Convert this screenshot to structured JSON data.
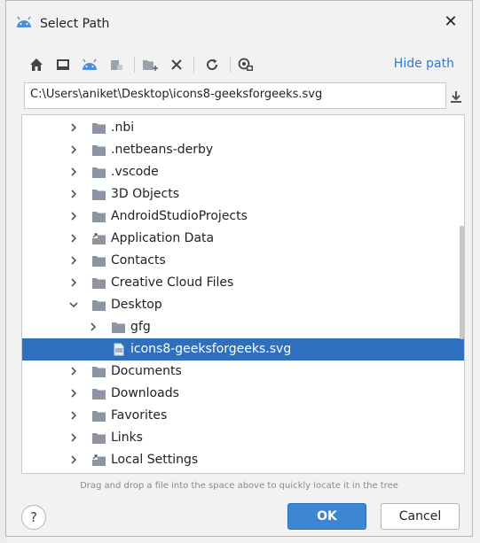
{
  "window": {
    "title": "Select Path"
  },
  "toolbar": {
    "buttons": [
      {
        "name": "home-icon"
      },
      {
        "name": "desktop-icon"
      },
      {
        "name": "android-project-icon"
      },
      {
        "name": "module-icon"
      },
      {
        "name": "new-folder-icon"
      },
      {
        "name": "delete-icon"
      },
      {
        "name": "refresh-icon"
      },
      {
        "name": "show-hidden-icon"
      }
    ],
    "hide_path_label": "Hide path"
  },
  "path": {
    "value": "C:\\Users\\aniket\\Desktop\\icons8-geeksforgeeks.svg"
  },
  "tree": {
    "items": [
      {
        "label": ".nbi",
        "type": "folder",
        "expanded": false,
        "level": 0
      },
      {
        "label": ".netbeans-derby",
        "type": "folder",
        "expanded": false,
        "level": 0
      },
      {
        "label": ".vscode",
        "type": "folder",
        "expanded": false,
        "level": 0
      },
      {
        "label": "3D Objects",
        "type": "folder",
        "expanded": false,
        "level": 0
      },
      {
        "label": "AndroidStudioProjects",
        "type": "folder",
        "expanded": false,
        "level": 0
      },
      {
        "label": "Application Data",
        "type": "folder-link",
        "expanded": false,
        "level": 0
      },
      {
        "label": "Contacts",
        "type": "folder",
        "expanded": false,
        "level": 0
      },
      {
        "label": "Creative Cloud Files",
        "type": "folder",
        "expanded": false,
        "level": 0
      },
      {
        "label": "Desktop",
        "type": "folder",
        "expanded": true,
        "level": 0
      },
      {
        "label": "gfg",
        "type": "folder",
        "expanded": false,
        "level": 1
      },
      {
        "label": "icons8-geeksforgeeks.svg",
        "type": "file",
        "selected": true,
        "level": 1
      },
      {
        "label": "Documents",
        "type": "folder",
        "expanded": false,
        "level": 0
      },
      {
        "label": "Downloads",
        "type": "folder",
        "expanded": false,
        "level": 0
      },
      {
        "label": "Favorites",
        "type": "folder",
        "expanded": false,
        "level": 0
      },
      {
        "label": "Links",
        "type": "folder",
        "expanded": false,
        "level": 0
      },
      {
        "label": "Local Settings",
        "type": "folder-link",
        "expanded": false,
        "level": 0
      }
    ]
  },
  "hint": "Drag and drop a file into the space above to quickly locate it in the tree",
  "buttons": {
    "help": "?",
    "ok": "OK",
    "cancel": "Cancel"
  },
  "colors": {
    "accent": "#3d86d4",
    "selection": "#2f6fbf",
    "link": "#2f7ad6",
    "folder": "#8c96a2",
    "android": "#4f8fd9"
  }
}
